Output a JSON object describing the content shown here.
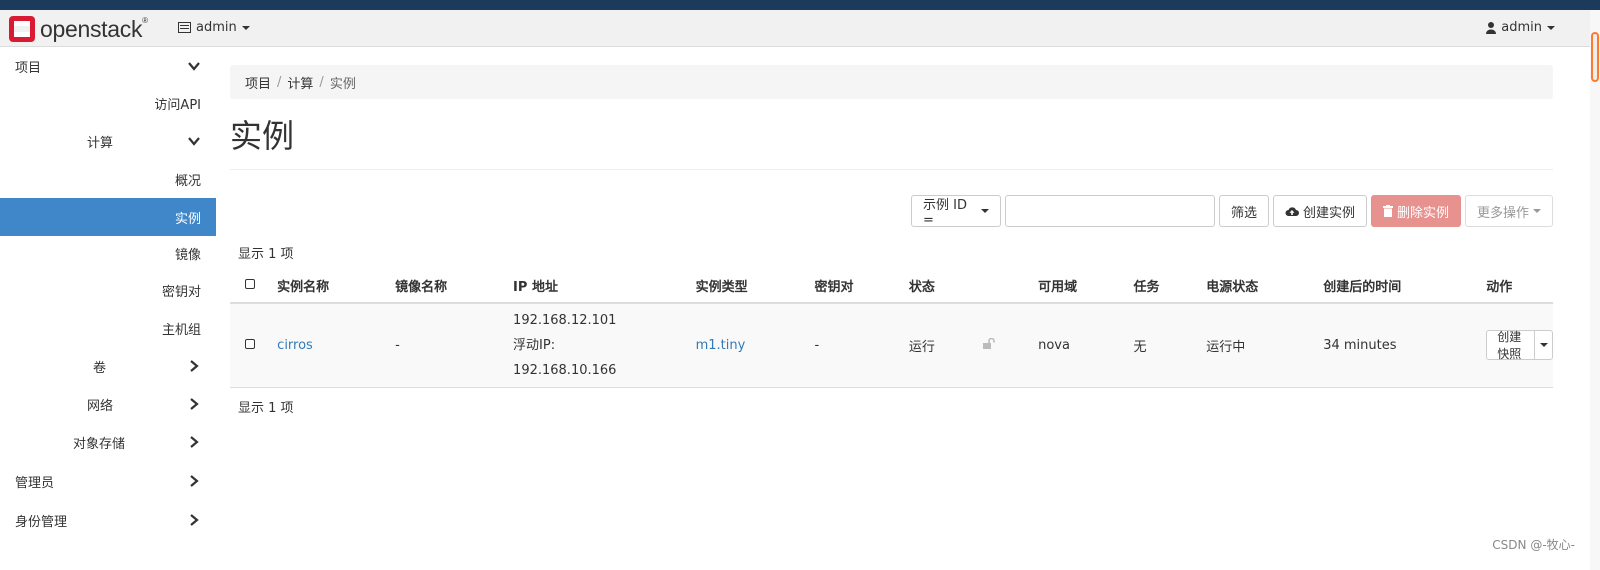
{
  "brand": {
    "name": "openstack",
    "mark": "®"
  },
  "navbar": {
    "project_label": "admin",
    "user_label": "admin"
  },
  "sidebar": {
    "project": "项目",
    "access_api": "访问API",
    "compute": "计算",
    "overview": "概况",
    "instances": "实例",
    "images": "镜像",
    "keypairs": "密钥对",
    "host_groups": "主机组",
    "volumes": "卷",
    "network": "网络",
    "object_store": "对象存储",
    "admin": "管理员",
    "identity": "身份管理"
  },
  "breadcrumb": {
    "items": [
      "项目",
      "计算",
      "实例"
    ],
    "separator": "/"
  },
  "page_title": "实例",
  "toolbar": {
    "filter_field": "示例 ID =",
    "filter_placeholder": "",
    "filter_button": "筛选",
    "create_button": "创建实例",
    "delete_button": "删除实例",
    "more_button": "更多操作"
  },
  "table": {
    "count_top": "显示 1 项",
    "count_bottom": "显示 1 项",
    "headers": [
      "实例名称",
      "镜像名称",
      "IP 地址",
      "实例类型",
      "密钥对",
      "状态",
      "可用域",
      "任务",
      "电源状态",
      "创建后的时间",
      "动作"
    ],
    "rows": [
      {
        "name": "cirros",
        "image": "-",
        "ip_fixed": "192.168.12.101",
        "ip_floating_label": "浮动IP:",
        "ip_floating": "192.168.10.166",
        "flavor": "m1.tiny",
        "keypair": "-",
        "status": "运行",
        "zone": "nova",
        "task": "无",
        "power": "运行中",
        "age": "34 minutes",
        "action": "创建快照"
      }
    ]
  },
  "watermark": "CSDN @-牧心-",
  "colors": {
    "active": "#3f87c8",
    "link": "#337ab7",
    "danger": "#e8928f",
    "topbar": "#1b3a5c"
  }
}
